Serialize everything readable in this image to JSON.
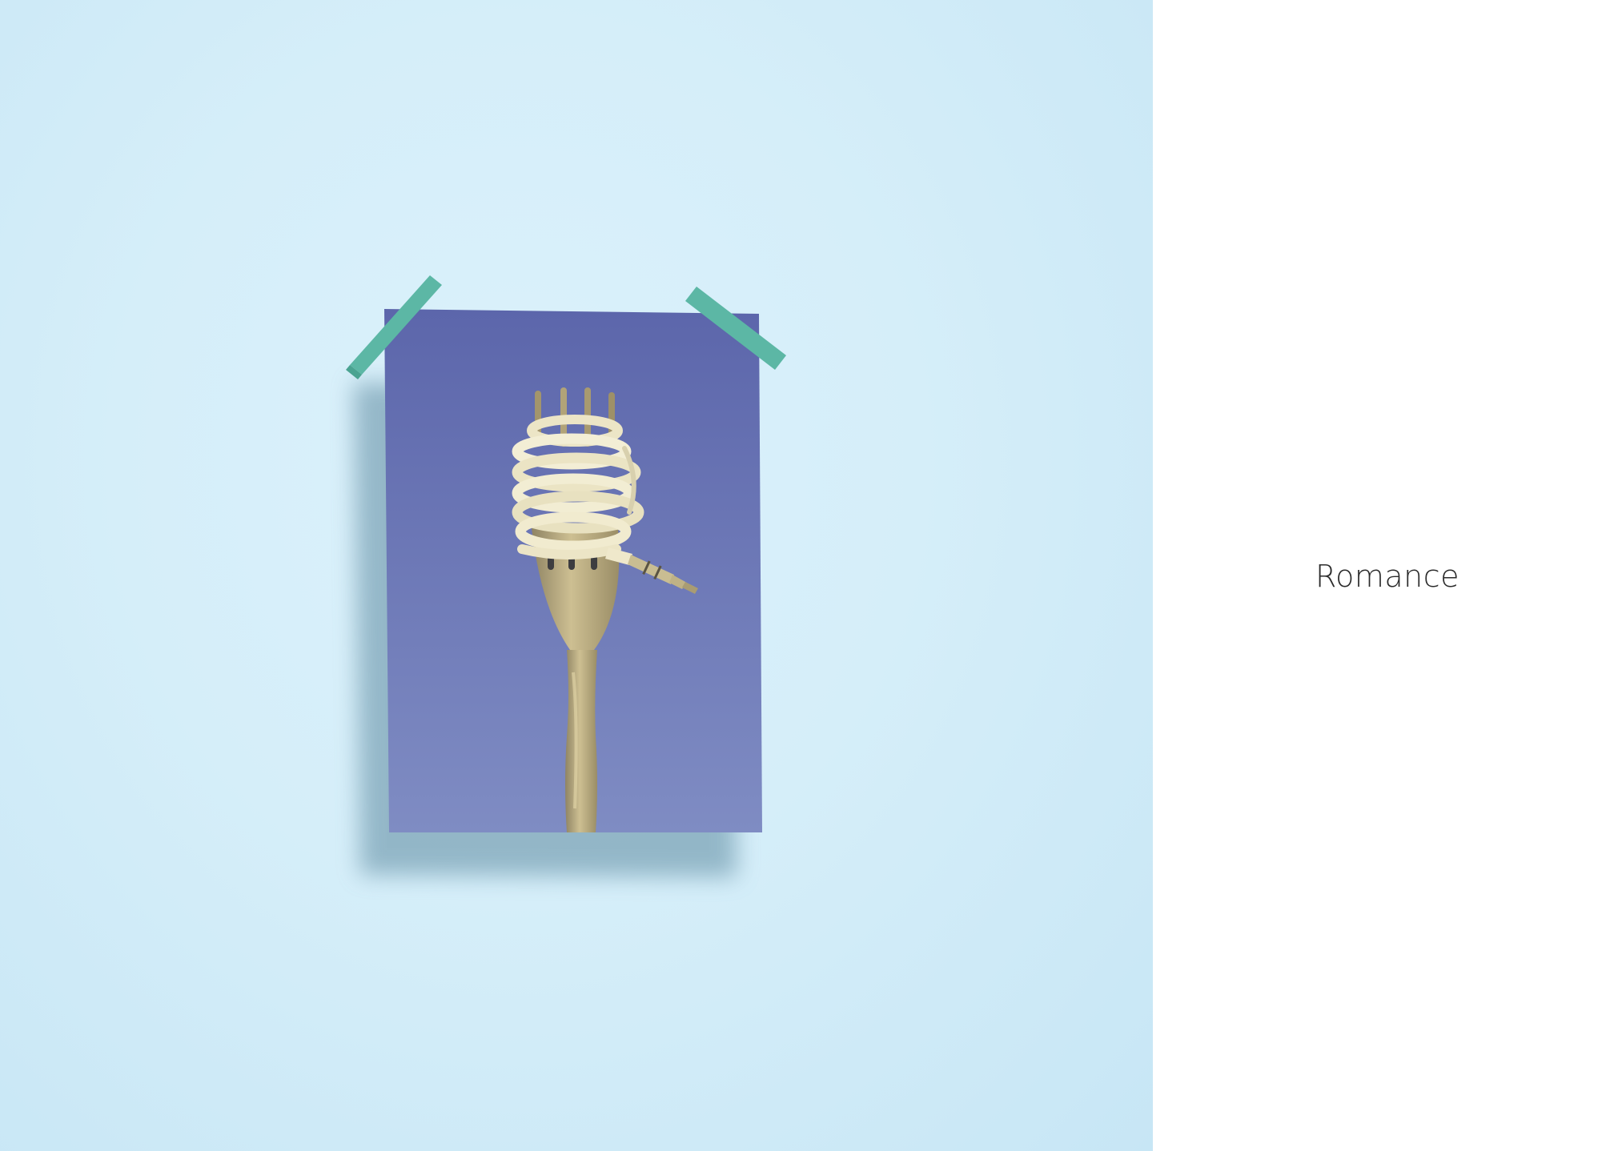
{
  "caption": {
    "text": "Romance"
  },
  "artwork": {
    "icons": [
      "fork-icon",
      "earphone-cable-icon",
      "audio-jack-icon",
      "tape-strip-icon"
    ],
    "colors": {
      "background": "#d7eff9",
      "poster": "#6c78b6",
      "tape": "#5cb7a5",
      "cable": "#f1ecd0",
      "fork": "#b7a77a"
    }
  }
}
